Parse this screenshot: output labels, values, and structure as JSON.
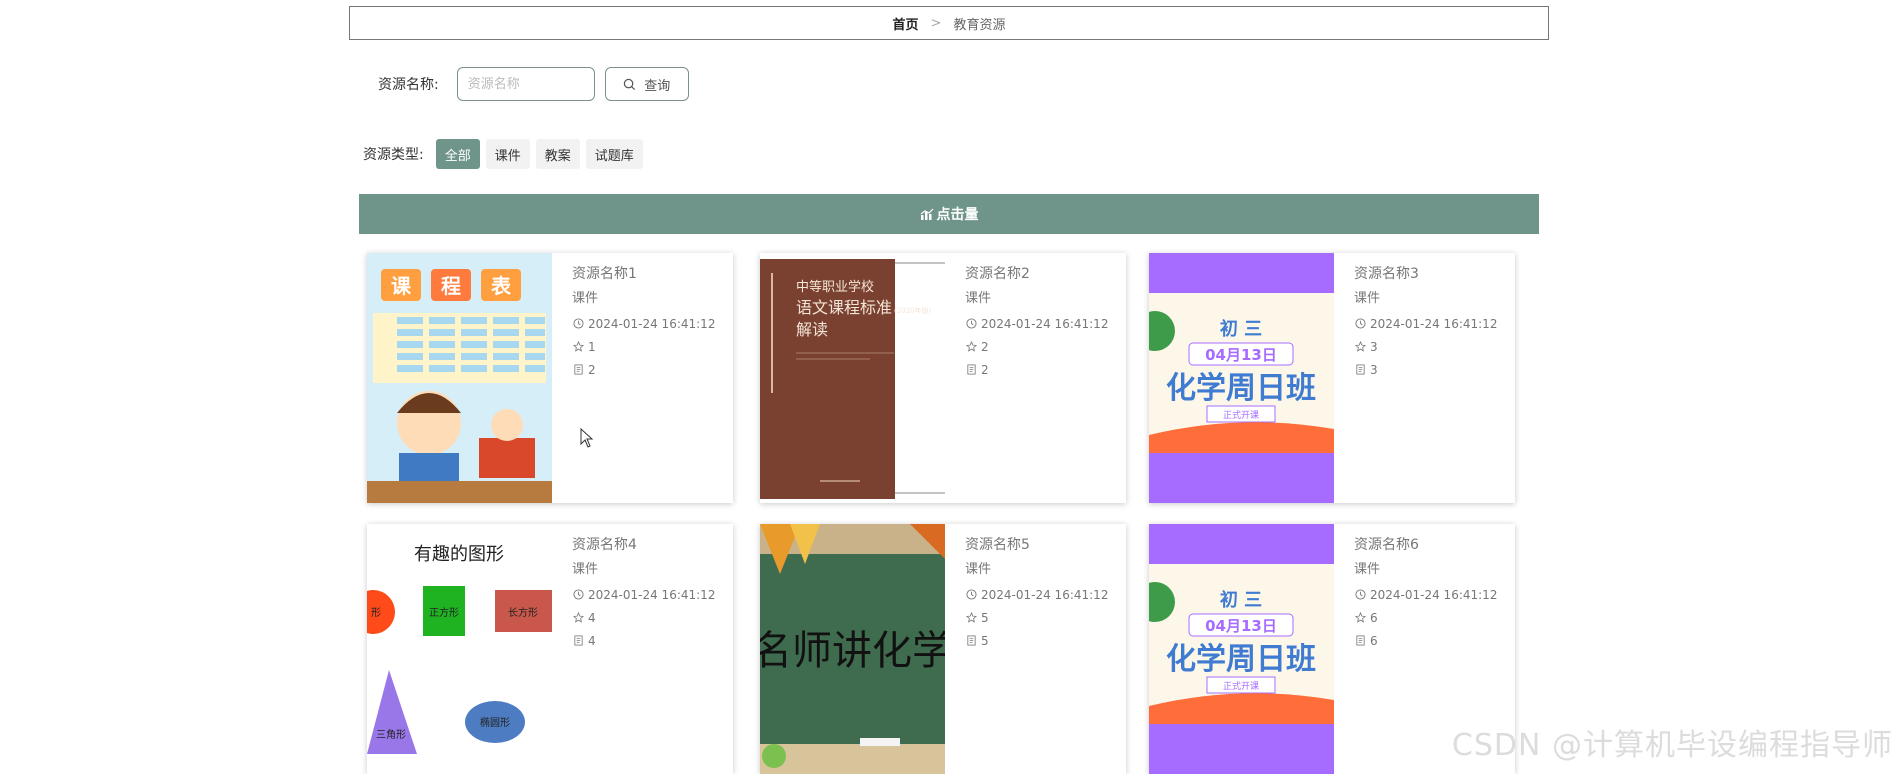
{
  "breadcrumb": {
    "home": "首页",
    "separator": ">",
    "current": "教育资源"
  },
  "search": {
    "label": "资源名称:",
    "placeholder": "资源名称",
    "value": "",
    "button_label": "查询"
  },
  "type_filter": {
    "label": "资源类型:",
    "options": [
      "全部",
      "课件",
      "教案",
      "试题库"
    ],
    "active": "全部"
  },
  "sort_bar": {
    "label": "点击量"
  },
  "cards": [
    {
      "name": "资源名称1",
      "type": "课件",
      "time": "2024-01-24 16:41:12",
      "stars": "1",
      "count": "2",
      "thumb_text": [
        "课",
        "程",
        "表"
      ]
    },
    {
      "name": "资源名称2",
      "type": "课件",
      "time": "2024-01-24 16:41:12",
      "stars": "2",
      "count": "2",
      "thumb_text": [
        "中等职业学校",
        "语文课程标准",
        "(2020年版)",
        "解读"
      ]
    },
    {
      "name": "资源名称3",
      "type": "课件",
      "time": "2024-01-24 16:41:12",
      "stars": "3",
      "count": "3",
      "thumb_text": [
        "初 三",
        "04月13日",
        "化学周日班",
        "正式开课"
      ]
    },
    {
      "name": "资源名称4",
      "type": "课件",
      "time": "2024-01-24 16:41:12",
      "stars": "4",
      "count": "4",
      "thumb_text": [
        "有趣的图形",
        "正方形",
        "长方形",
        "三角形",
        "椭圆形",
        "形"
      ]
    },
    {
      "name": "资源名称5",
      "type": "课件",
      "time": "2024-01-24 16:41:12",
      "stars": "5",
      "count": "5",
      "thumb_text": [
        "名师讲化学"
      ]
    },
    {
      "name": "资源名称6",
      "type": "课件",
      "time": "2024-01-24 16:41:12",
      "stars": "6",
      "count": "6",
      "thumb_text": [
        "初 三",
        "04月13日",
        "化学周日班",
        "正式开课"
      ]
    }
  ],
  "watermark": "CSDN @计算机毕设编程指导师",
  "colors": {
    "accent": "#6f948a",
    "purple": "#a66cff",
    "board": "#3f6b4e",
    "book": "#7a4130"
  }
}
